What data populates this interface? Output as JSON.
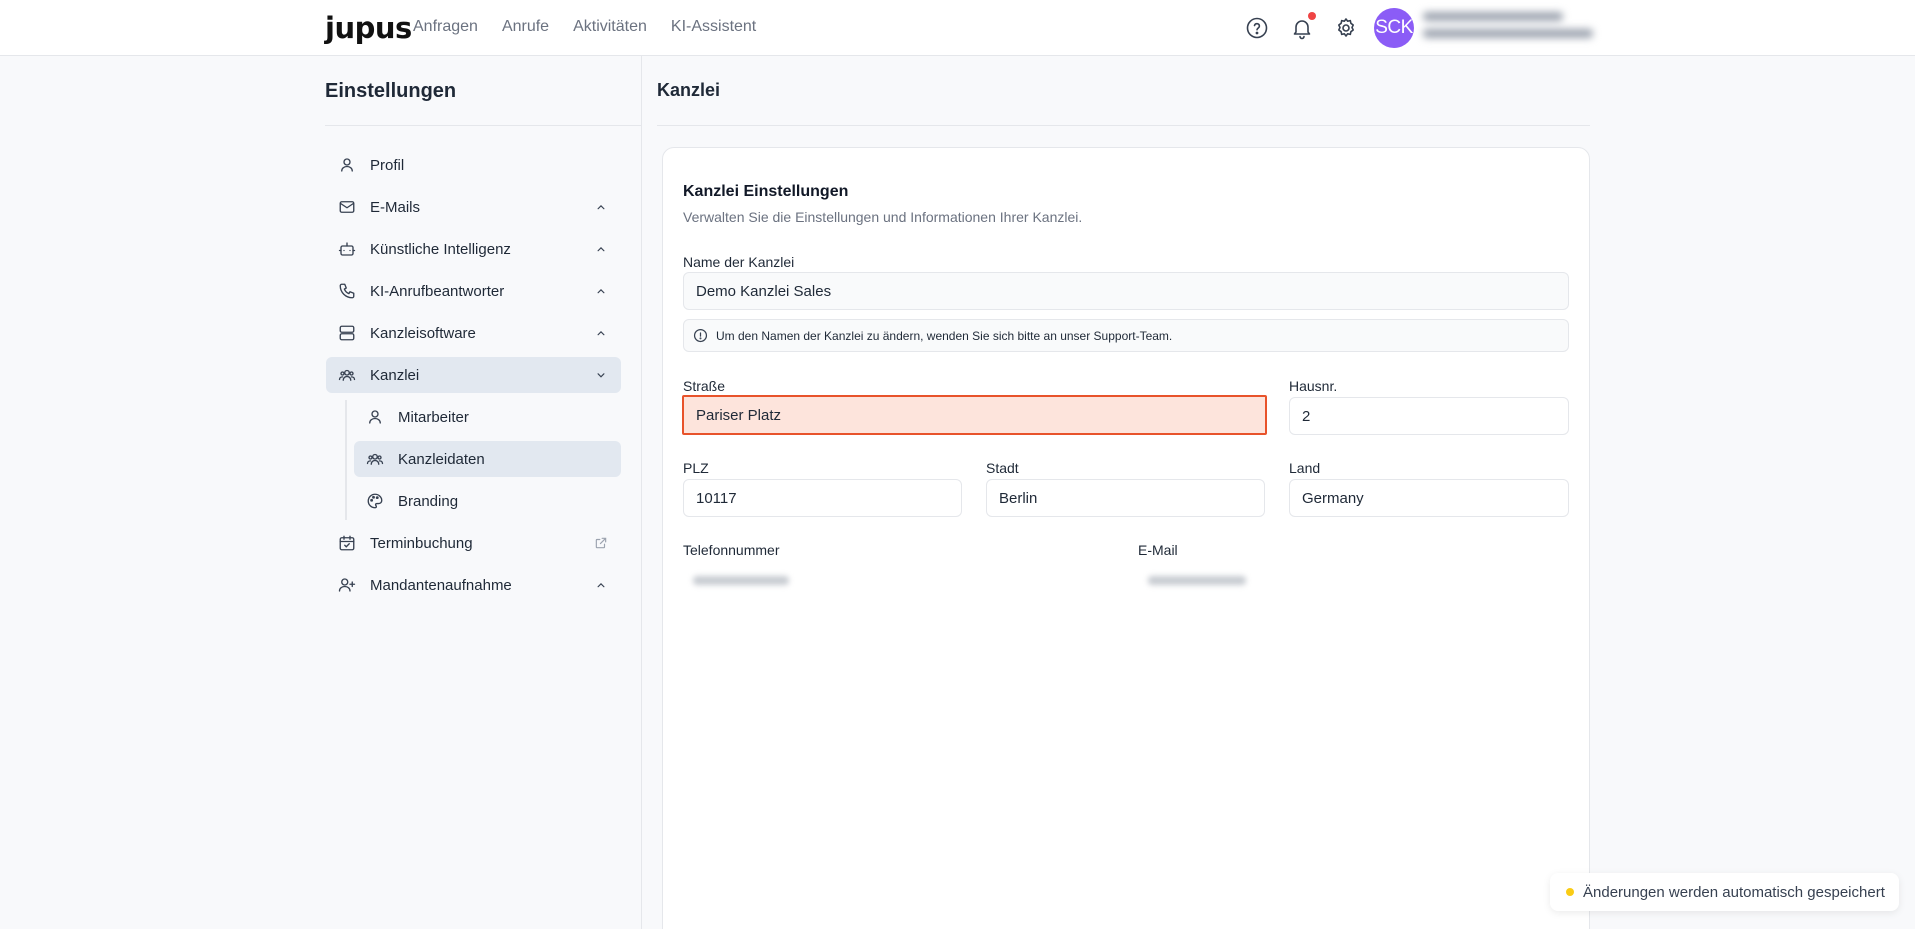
{
  "brand": {
    "logo_text": "jupus"
  },
  "nav": {
    "items": [
      "Anfragen",
      "Anrufe",
      "Aktivitäten",
      "KI-Assistent"
    ]
  },
  "header": {
    "avatar_initials": "SCK",
    "icons": [
      "help-icon",
      "bell-icon",
      "gear-icon"
    ],
    "notification_dot_color": "#ef4444",
    "avatar_color": "#8b5cf6"
  },
  "sidebar": {
    "title": "Einstellungen",
    "items": [
      {
        "label": "Profil",
        "icon": "user-icon"
      },
      {
        "label": "E-Mails",
        "icon": "mail-icon"
      },
      {
        "label": "Künstliche Intelligenz",
        "icon": "bot-icon"
      },
      {
        "label": "KI-Anrufbeantworter",
        "icon": "phone-icon"
      },
      {
        "label": "Kanzleisoftware",
        "icon": "server-icon"
      },
      {
        "label": "Kanzlei",
        "icon": "team-icon"
      },
      {
        "label": "Terminbuchung",
        "icon": "calendar-icon"
      },
      {
        "label": "Mandantenaufnahme",
        "icon": "user-plus-icon"
      }
    ],
    "sub_items": [
      {
        "label": "Mitarbeiter",
        "icon": "user-icon"
      },
      {
        "label": "Kanzleidaten",
        "icon": "team-icon"
      },
      {
        "label": "Branding",
        "icon": "palette-icon"
      }
    ]
  },
  "main": {
    "page_title": "Kanzlei",
    "card": {
      "title": "Kanzlei Einstellungen",
      "description": "Verwalten Sie die Einstellungen und Informationen Ihrer Kanzlei.",
      "name_label": "Name der Kanzlei",
      "name_value": "Demo Kanzlei Sales",
      "info_text": "Um den Namen der Kanzlei zu ändern, wenden Sie sich bitte an unser Support-Team.",
      "street_label": "Straße",
      "street_value": "Pariser Platz",
      "house_label": "Hausnr.",
      "house_value": "2",
      "zip_label": "PLZ",
      "zip_value": "10117",
      "city_label": "Stadt",
      "city_value": "Berlin",
      "country_label": "Land",
      "country_value": "Germany",
      "phone_label": "Telefonnummer",
      "email_label": "E-Mail"
    }
  },
  "toast": {
    "text": "Änderungen werden automatisch gespeichert",
    "dot_color": "#facc15"
  },
  "colors": {
    "highlight_border": "#e8532b",
    "highlight_bg": "#fde4dc",
    "active_item_bg": "#e2e8f0"
  }
}
